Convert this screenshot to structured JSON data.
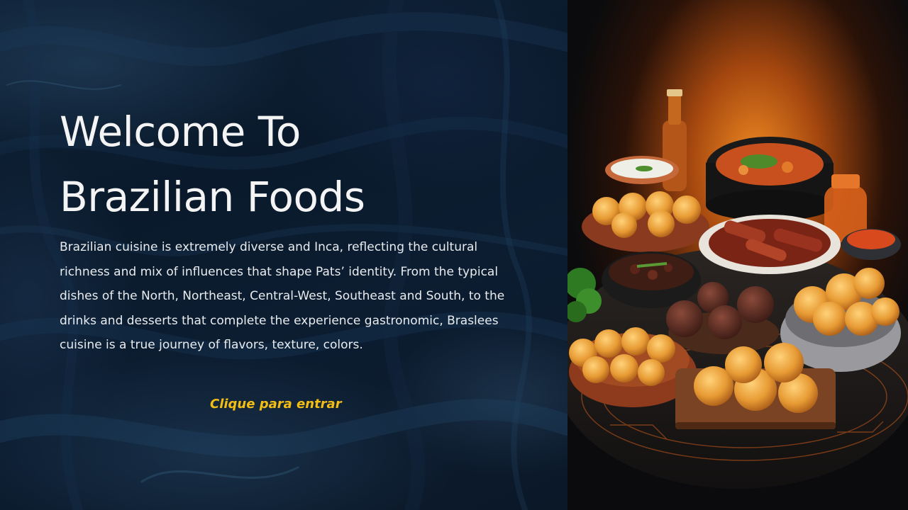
{
  "slide": {
    "title_line1": "Welcome To",
    "title_line2": "Brazilian Foods",
    "description": "Brazilian cuisine is extremely diverse and Inca, reflecting the cultural richness and mix of influences that shape Pats’ identity. From the typical dishes of the North, Northeast, Central-West, Southeast and South, to the drinks and desserts that complete the experience gastronomic, Braslees cuisine is a true journey of flavors, texture, colors.",
    "cta_label": "Clique para entrar"
  },
  "colors": {
    "background": "#0c1d31",
    "title": "#f4f4f4",
    "body": "#e9ecef",
    "cta": "#f3bd14",
    "food_glow": "#e8791c"
  },
  "image": {
    "subject": "brazilian-food-spread"
  }
}
